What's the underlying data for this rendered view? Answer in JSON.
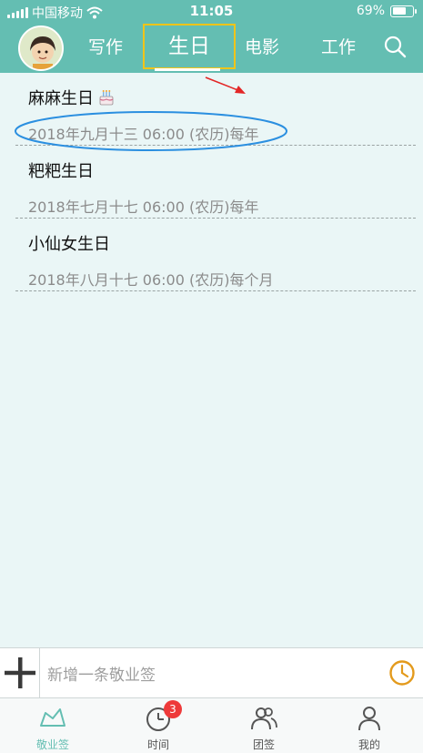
{
  "status_bar": {
    "carrier": "中国移动",
    "time": "11:05",
    "battery": "69%",
    "battery_level": 0.69
  },
  "tabs": [
    {
      "label": "写作"
    },
    {
      "label": "生日"
    },
    {
      "label": "电影"
    },
    {
      "label": "工作"
    }
  ],
  "active_tab": "生日",
  "items": [
    {
      "title": "麻麻生日",
      "detail": "2018年九月十三 06:00 (农历)每年",
      "icon": "birthday-cake-icon"
    },
    {
      "title": "粑粑生日",
      "detail": "2018年七月十七 06:00 (农历)每年"
    },
    {
      "title": "小仙女生日",
      "detail": "2018年八月十七 06:00 (农历)每个月"
    }
  ],
  "input": {
    "placeholder": "新增一条敬业签"
  },
  "tabbar": [
    {
      "label": "敬业签",
      "icon": "note-icon"
    },
    {
      "label": "时间",
      "icon": "clock-icon",
      "badge": "3"
    },
    {
      "label": "团签",
      "icon": "group-icon"
    },
    {
      "label": "我的",
      "icon": "profile-icon"
    }
  ],
  "colors": {
    "header": "#64beb2",
    "active_border": "#f0c419",
    "badge": "#ee3a3a",
    "annotation": "#2b8fe0",
    "arrow": "#e32626",
    "clock": "#e39a1c"
  }
}
